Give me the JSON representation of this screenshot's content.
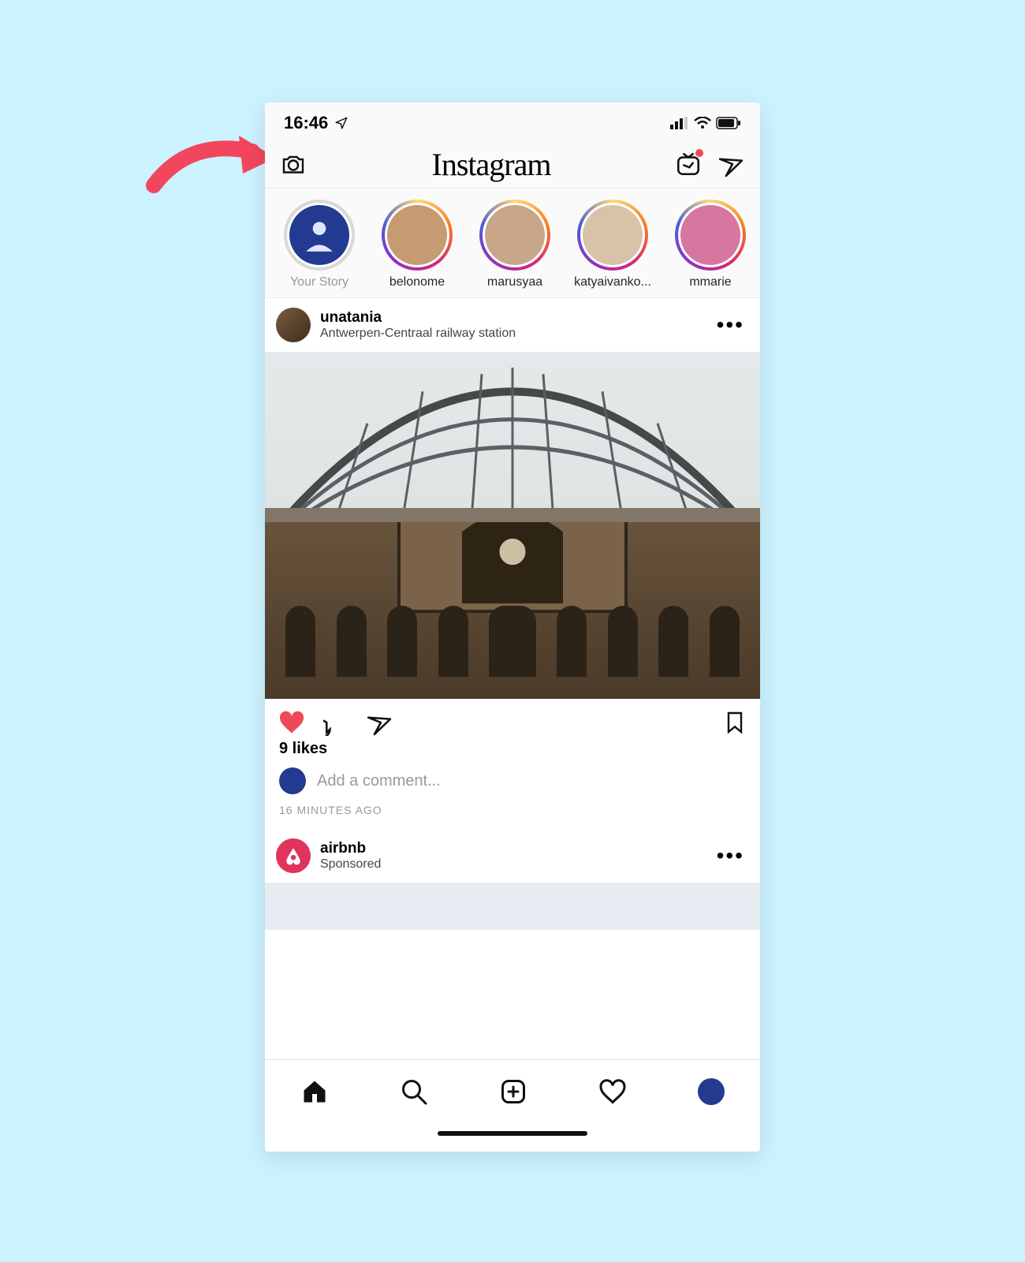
{
  "status_bar": {
    "time": "16:46"
  },
  "header": {
    "app_name": "Instagram"
  },
  "stories": [
    {
      "label": "Your Story",
      "own": true
    },
    {
      "label": "belonome"
    },
    {
      "label": "marusyaa"
    },
    {
      "label": "katyaivanko..."
    },
    {
      "label": "mmarie"
    }
  ],
  "post": {
    "username": "unatania",
    "location": "Antwerpen-Centraal railway station",
    "liked": true,
    "likes_text": "9 likes",
    "comment_placeholder": "Add a comment...",
    "time_ago": "16 MINUTES AGO"
  },
  "sponsored": {
    "name": "airbnb",
    "subtitle": "Sponsored"
  },
  "colors": {
    "like_red": "#ed4956",
    "airbnb": "#e0335d",
    "story_ring": [
      "#feda75",
      "#fa7e1e",
      "#d62976",
      "#962fbf",
      "#4f5bd5"
    ]
  }
}
